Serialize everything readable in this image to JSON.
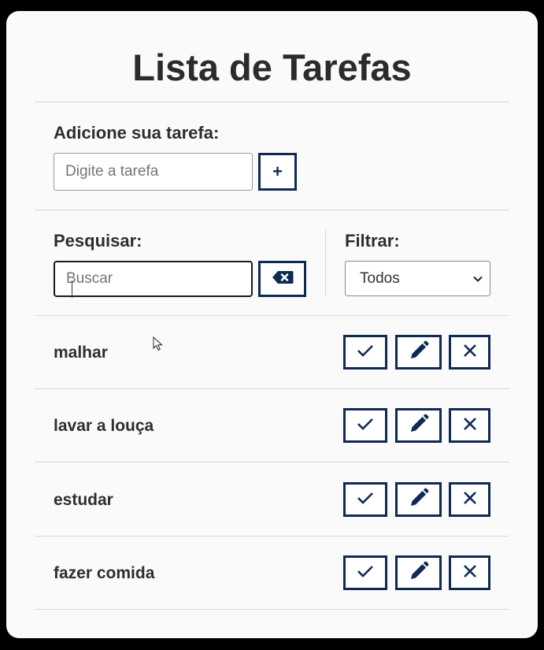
{
  "app": {
    "title": "Lista de Tarefas"
  },
  "add_form": {
    "label": "Adicione sua tarefa:",
    "placeholder": "Digite a tarefa",
    "value": "",
    "add_button_label": "+"
  },
  "search": {
    "label": "Pesquisar:",
    "placeholder": "Buscar",
    "value": "",
    "clear_icon": "backspace-icon"
  },
  "filter": {
    "label": "Filtrar:",
    "selected": "Todos"
  },
  "tasks": [
    {
      "text": "malhar"
    },
    {
      "text": "lavar a louça"
    },
    {
      "text": "estudar"
    },
    {
      "text": "fazer comida"
    }
  ],
  "task_actions": [
    "check-icon",
    "pencil-icon",
    "close-icon"
  ],
  "colors": {
    "accent": "#0f2a55",
    "card_background": "#fafafa",
    "page_background": "#000000",
    "text": "#2e2e2e",
    "divider": "#d9d9d9"
  }
}
